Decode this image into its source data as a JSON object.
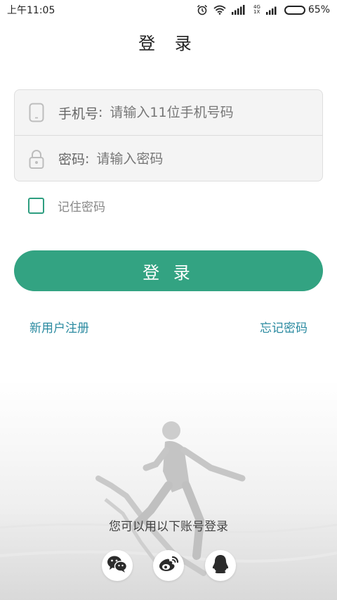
{
  "status_bar": {
    "time": "上午11:05",
    "network": "4G",
    "network_sub": "1X",
    "battery": "65%",
    "battery_level": 0.65
  },
  "header": {
    "title": "登 录"
  },
  "form": {
    "phone": {
      "label": "手机号",
      "sep": ":",
      "placeholder": "请输入11位手机号码",
      "icon": "phone-icon"
    },
    "password": {
      "label": "密码",
      "sep": ":",
      "placeholder": "请输入密码",
      "icon": "lock-icon"
    },
    "remember_label": "记住密码"
  },
  "login_button": "登 录",
  "links": {
    "register": "新用户注册",
    "forgot": "忘记密码"
  },
  "social": {
    "caption": "您可以用以下账号登录",
    "providers": [
      "wechat-icon",
      "weibo-icon",
      "qq-icon"
    ]
  },
  "colors": {
    "accent": "#33a382",
    "link": "#2a8aa0",
    "checkbox": "#2e9e80"
  }
}
